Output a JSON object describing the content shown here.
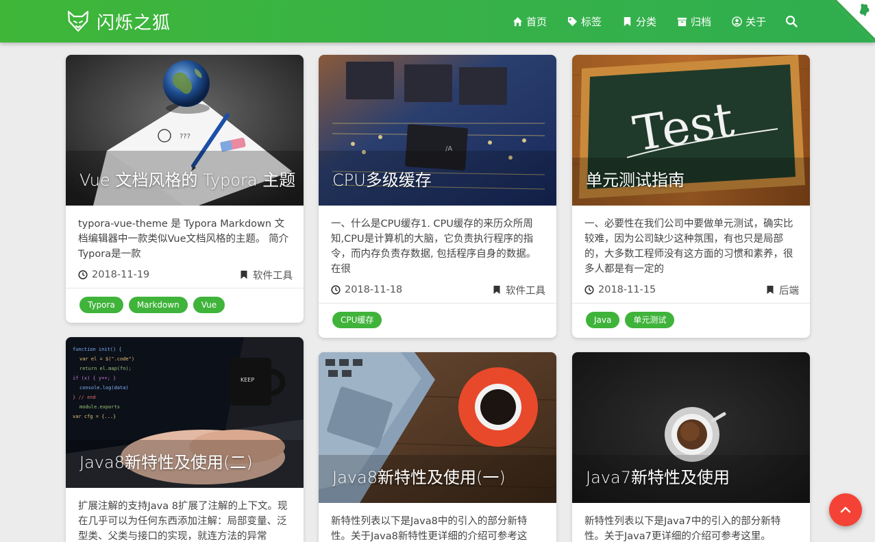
{
  "header": {
    "site_title": "闪烁之狐",
    "nav": [
      {
        "label": "首页",
        "icon": "home-icon"
      },
      {
        "label": "标签",
        "icon": "tag-icon"
      },
      {
        "label": "分类",
        "icon": "bookmark-icon"
      },
      {
        "label": "归档",
        "icon": "archive-icon"
      },
      {
        "label": "关于",
        "icon": "user-circle-icon"
      }
    ],
    "search_icon": "search-icon",
    "corner_icon": "github-corner-icon"
  },
  "colors": {
    "header_green": "#3fb638",
    "tag_green": "#3fb33a",
    "top_button_red": "#f44336",
    "background": "#ececec"
  },
  "cards": [
    {
      "title": "Vue 文档风格的 Typora 主题",
      "summary": "typora-vue-theme 是 Typora Markdown 文档编辑器中一款类似Vue文档风格的主题。 简介Typora是一款",
      "date": "2018-11-19",
      "category": "软件工具",
      "tags": [
        "Typora",
        "Markdown",
        "Vue"
      ]
    },
    {
      "title": "CPU多级缓存",
      "summary": "一、什么是CPU缓存1. CPU缓存的来历众所周知,CPU是计算机的大脑，它负责执行程序的指令，而内存负责存数据, 包括程序自身的数据。在很",
      "date": "2018-11-18",
      "category": "软件工具",
      "tags": [
        "CPU缓存"
      ]
    },
    {
      "title": "单元测试指南",
      "summary": "一、必要性在我们公司中要做单元测试，确实比较难，因为公司缺少这种氛围，有也只是局部的，大多数工程师没有这方面的习惯和素养，很多人都是有一定的",
      "date": "2018-11-15",
      "category": "后端",
      "tags": [
        "Java",
        "单元测试"
      ]
    },
    {
      "title": "Java8新特性及使用(二)",
      "summary": "扩展注解的支持Java 8扩展了注解的上下文。现在几乎可以为任何东西添加注解：局部变量、泛型类、父类与接口的实现，就连方法的异常"
    },
    {
      "title": "Java8新特性及使用(一)",
      "summary": "新特性列表以下是Java8中的引入的部分新特性。关于Java8新特性更详细的介绍可参考这"
    },
    {
      "title": "Java7新特性及使用",
      "summary": "新特性列表以下是Java7中的引入的部分新特性。关于Java7更详细的介绍可参考这里。"
    }
  ],
  "scroll_top_icon": "chevron-up-icon"
}
